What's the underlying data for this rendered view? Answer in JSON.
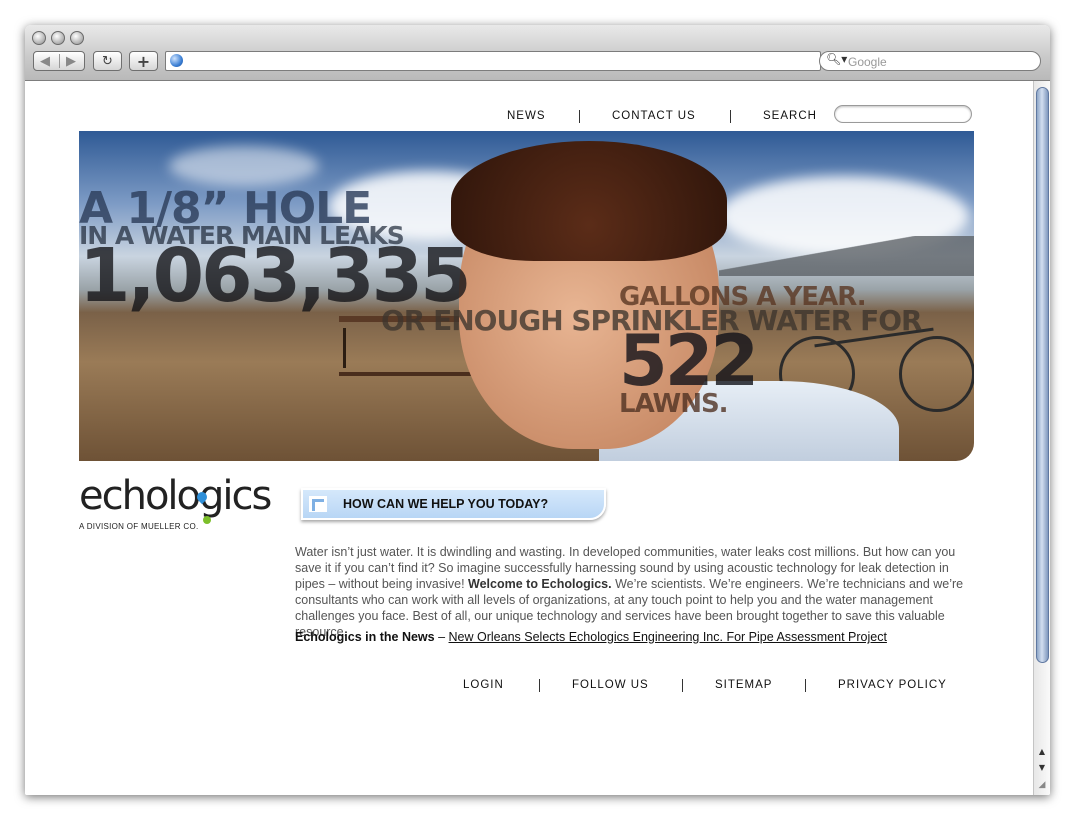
{
  "browser": {
    "back_icon": "back-arrow-icon",
    "forward_icon": "forward-arrow-icon",
    "reload_label": "↻",
    "add_label": "+",
    "url_value": "",
    "search_placeholder": "Google"
  },
  "top_nav": {
    "news": "NEWS",
    "contact": "CONTACT US",
    "search": "SEARCH",
    "search_value": ""
  },
  "hero": {
    "line1": "A 1/8” HOLE",
    "line2": "IN A WATER MAIN LEAKS",
    "line3": "1,063,335",
    "line4": "GALLONS A YEAR.",
    "line5": "OR ENOUGH SPRINKLER WATER FOR",
    "line6": "522",
    "line7": "LAWNS."
  },
  "logo": {
    "name": "echologics",
    "subtitle": "A DIVISION OF MUELLER CO."
  },
  "help_banner": "HOW CAN WE HELP YOU TODAY?",
  "intro": {
    "part1": "Water isn’t just water. It is dwindling and wasting. In developed communities, water leaks cost millions. But how can you save it if you can’t find it? So imagine successfully harnessing sound by using acoustic technology for leak detection in pipes – without being invasive! ",
    "welcome": "Welcome to Echologics.",
    "part2": " We’re scientists. We’re engineers. We’re technicians and we’re consultants who can work with all levels of organizations, at any touch point to help you and the water management challenges you face. Best of all, our unique technology and services have been brought together to save this valuable resource."
  },
  "news": {
    "label": "Echologics in the News",
    "dash": " – ",
    "link": "New Orleans Selects Echologics Engineering Inc. For Pipe Assessment Project"
  },
  "footer_nav": {
    "login": "LOGIN",
    "follow": "FOLLOW US",
    "sitemap": "SITEMAP",
    "privacy": "PRIVACY POLICY"
  },
  "colors": {
    "accent_blue": "#b8d6f5",
    "text_gray": "#555555"
  }
}
